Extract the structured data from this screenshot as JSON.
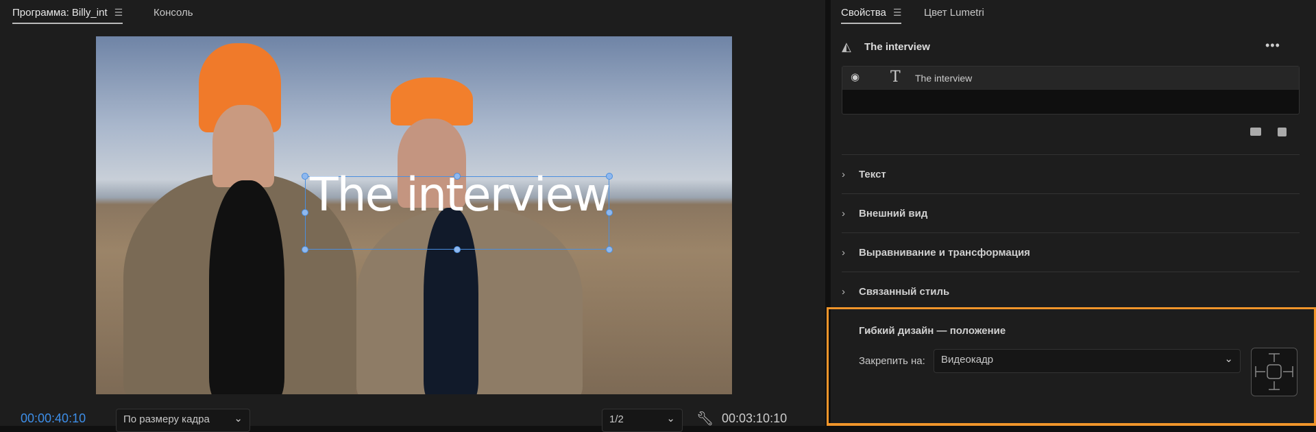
{
  "program_monitor": {
    "tabs": [
      {
        "label": "Программа: Billy_int",
        "active": true
      },
      {
        "label": "Консоль",
        "active": false
      }
    ],
    "overlay_text": "The interview",
    "current_timecode": "00:00:40:10",
    "zoom_select": "По размеру кадра",
    "resolution_select": "1/2",
    "duration_timecode": "00:03:10:10"
  },
  "properties": {
    "tabs": [
      {
        "label": "Свойства",
        "active": true
      },
      {
        "label": "Цвет Lumetri",
        "active": false
      }
    ],
    "title": "The interview",
    "layer_name": "The interview",
    "sections": [
      "Текст",
      "Внешний вид",
      "Выравнивание и трансформация",
      "Связанный стиль"
    ],
    "responsive": {
      "title": "Гибкий дизайн — положение",
      "pin_label": "Закрепить на:",
      "pin_value": "Видеокадр"
    }
  },
  "colors": {
    "highlight": "#f0952a",
    "timecode": "#3d8ee8",
    "selection": "#4a8fe0"
  }
}
